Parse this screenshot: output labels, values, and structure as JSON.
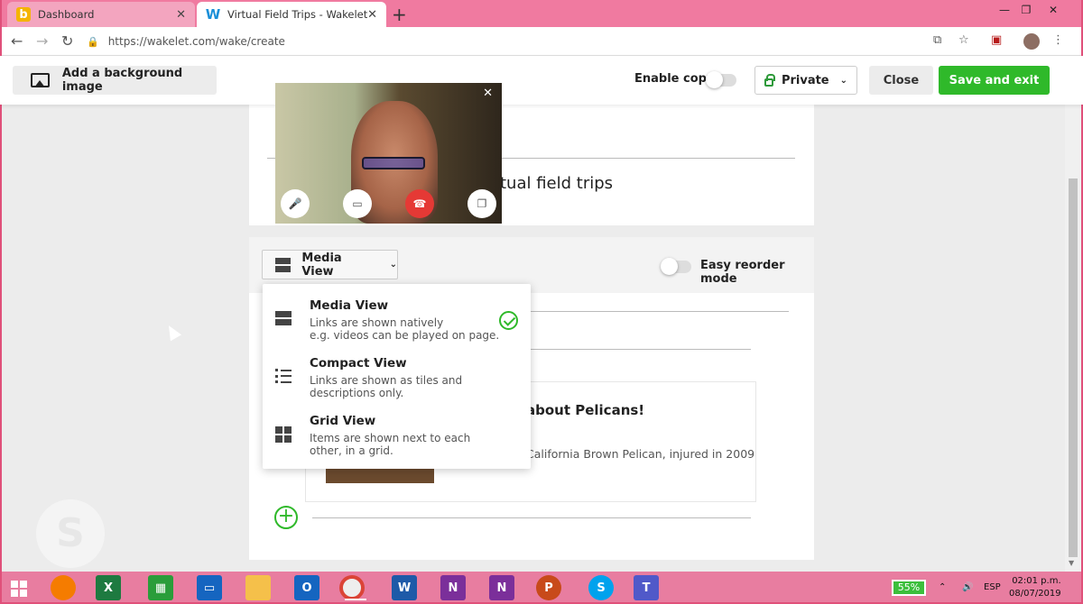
{
  "browser": {
    "tabs": [
      {
        "label": "Dashboard",
        "favicon": "b"
      },
      {
        "label": "Virtual Field Trips - Wakelet",
        "favicon": "W"
      }
    ],
    "url": "https://wakelet.com/wake/create"
  },
  "header": {
    "background_label": "Add a background image",
    "enable_copy_label": "Enable copy",
    "privacy_label": "Private",
    "close_label": "Close",
    "save_label": "Save and exit"
  },
  "collection": {
    "title": "tual field trips"
  },
  "view_bar": {
    "selected_view": "Media View",
    "reorder_label": "Easy reorder mode"
  },
  "dropdown": {
    "items": [
      {
        "label": "Media View",
        "description": "Links are shown natively\ne.g. videos can be played on page.",
        "selected": true
      },
      {
        "label": "Compact View",
        "description": "Links are shown as tiles and\ndescriptions only.",
        "selected": false
      },
      {
        "label": "Grid View",
        "description": "Items are shown next to each\nother, in a grid.",
        "selected": false
      }
    ]
  },
  "link_card": {
    "title": "about Pelicans!",
    "description": "California Brown Pelican, injured in 2009"
  },
  "taskbar": {
    "battery": "55%",
    "language": "ESP",
    "time": "02:01 p.m.",
    "date": "08/07/2019"
  },
  "colors": {
    "accent_green": "#2fb92a",
    "chrome_pink": "#f07aa0"
  }
}
